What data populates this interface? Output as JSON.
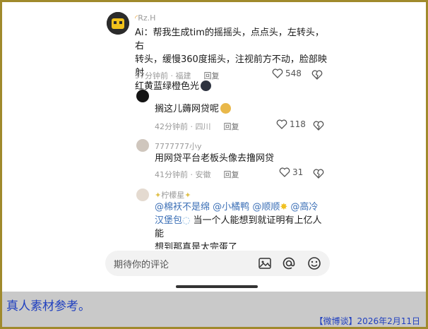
{
  "comments": [
    {
      "username": "Rz.H",
      "text_lines": [
        "Ai：帮我生成tim的摇摇头，点点头，左转头，右",
        "转头，缓慢360度摇头，注视前方不动，脸部映射",
        "红黄蓝绿橙色光"
      ],
      "time": "57分钟前",
      "location": "福建",
      "reply_label": "回复",
      "likes": "548"
    },
    {
      "username": "",
      "text_lines": [
        "搁这儿薅网贷呢"
      ],
      "time": "42分钟前",
      "location": "四川",
      "reply_label": "回复",
      "likes": "118"
    },
    {
      "username": "7777777小y",
      "text_lines": [
        "用网贷平台老板头像去撸网贷"
      ],
      "time": "41分钟前",
      "location": "安徽",
      "reply_label": "回复",
      "likes": "31"
    },
    {
      "username": "柠檬星",
      "mentions": [
        "@棉袄不是绵",
        "@小橘鸭",
        "@顺顺",
        "@高冷",
        "汉堡包"
      ],
      "text_rest_line2": "当一个人能想到就证明有上亿人能",
      "text_line3": "想到那真是太完蛋了"
    }
  ],
  "input_bar": {
    "placeholder": "期待你的评论",
    "icons": [
      "image-icon",
      "at-icon",
      "emoji-icon"
    ]
  },
  "caption": {
    "title": "真人素材参考。",
    "footer": "【微博谈】2026年2月11日"
  },
  "colors": {
    "frame": "#a08a2c",
    "caption_band": "#c9c9c9",
    "caption_text": "#1f3fbf",
    "mention": "#3b6fb6"
  }
}
